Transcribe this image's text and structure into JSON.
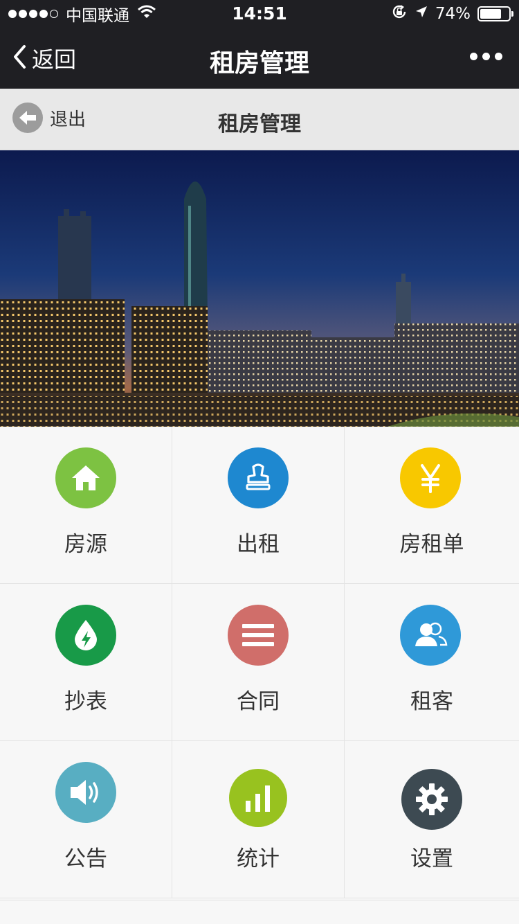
{
  "status_bar": {
    "carrier": "中国联通",
    "time": "14:51",
    "battery": "74%",
    "battery_level": 0.74,
    "icons": [
      "signal-dots-icon",
      "wifi-icon",
      "rotation-lock-icon",
      "location-arrow-icon",
      "battery-icon"
    ]
  },
  "nav_bar": {
    "back_label": "返回",
    "title": "租房管理",
    "more_icon": "more-dots-icon"
  },
  "page_header": {
    "exit_label": "退出",
    "title": "租房管理"
  },
  "banner": {
    "subject": "city-skyline-night"
  },
  "menu": {
    "items": [
      {
        "label": "房源",
        "icon": "house-icon",
        "color": "#7dc242"
      },
      {
        "label": "出租",
        "icon": "stamp-icon",
        "color": "#1e88d0"
      },
      {
        "label": "房租单",
        "icon": "yen-icon",
        "color": "#f8c800"
      },
      {
        "label": "抄表",
        "icon": "water-drop-icon",
        "color": "#189a48"
      },
      {
        "label": "合同",
        "icon": "list-lines-icon",
        "color": "#d06e6a"
      },
      {
        "label": "租客",
        "icon": "users-icon",
        "color": "#2f99d8"
      },
      {
        "label": "公告",
        "icon": "speaker-icon",
        "color": "#58aec2"
      },
      {
        "label": "统计",
        "icon": "bar-chart-icon",
        "color": "#98c21f"
      },
      {
        "label": "设置",
        "icon": "gear-icon",
        "color": "#3d4a52"
      }
    ]
  }
}
